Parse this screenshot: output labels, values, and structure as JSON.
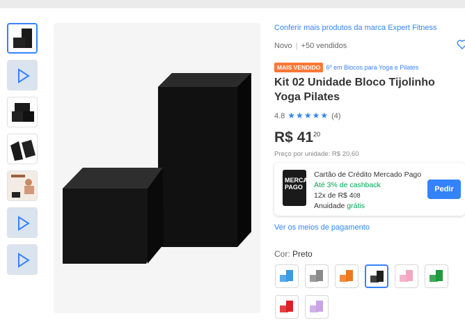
{
  "gallery": {
    "thumbnails": [
      {
        "name": "thumb-blocks-black",
        "kind": "image"
      },
      {
        "name": "thumb-video-1",
        "kind": "video"
      },
      {
        "name": "thumb-blocks-stacked",
        "kind": "image"
      },
      {
        "name": "thumb-blocks-angled",
        "kind": "image"
      },
      {
        "name": "thumb-yoga-person",
        "kind": "image"
      },
      {
        "name": "thumb-video-2",
        "kind": "video"
      },
      {
        "name": "thumb-video-3",
        "kind": "video"
      }
    ],
    "selected_index": 0
  },
  "product": {
    "brand_link": "Conferir mais produtos da marca Expert Fitness",
    "condition": "Novo",
    "sold": "+50 vendidos",
    "badge": "MAIS VENDIDO",
    "ranking": "6º em Blocos para Yoga e Pilates",
    "title": "Kit 02 Unidade Bloco Tijolinho Yoga Pilates",
    "rating_value": "4.8",
    "stars": "★★★★★",
    "review_count": "(4)",
    "price_currency": "R$",
    "price_int": "41",
    "price_cents": "20",
    "unit_price": "Preço por unidade: R$ 20,60"
  },
  "credit_card": {
    "card_text": "MERCADO PAGO",
    "title": "Cartão de Crédito Mercado Pago",
    "cashback": "Até 3% de cashback",
    "installments_prefix": "12x de R$ 4",
    "installments_cents": "08",
    "annuity_label": "Anuidade",
    "annuity_value": "grátis",
    "button": "Pedir"
  },
  "payment_link": "Ver os meios de pagamento",
  "color": {
    "label": "Cor:",
    "selected": "Preto",
    "options": [
      {
        "name": "Azul",
        "color": "#3a9ae6"
      },
      {
        "name": "Cinza",
        "color": "#8a8a8a"
      },
      {
        "name": "Laranja",
        "color": "#f07818"
      },
      {
        "name": "Preto",
        "color": "#1f1f1f"
      },
      {
        "name": "Rosa",
        "color": "#f3a6c2"
      },
      {
        "name": "Verde",
        "color": "#1d9a3c"
      },
      {
        "name": "Vermelho",
        "color": "#e01e25"
      },
      {
        "name": "Lilás",
        "color": "#c9a3e6"
      }
    ]
  },
  "colors": {
    "accent": "#3483fa",
    "badge": "#ff7733",
    "green": "#00a650"
  }
}
